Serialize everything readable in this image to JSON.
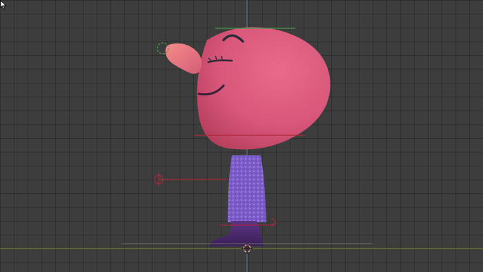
{
  "viewport": {
    "mode": "3d-viewport",
    "view": "side-orthographic",
    "grid": true
  },
  "colors": {
    "background": "#3d3d3d",
    "grid_line": "#2c2c2c",
    "vertical_axis": "#5a7fa0",
    "ground_axis": "#7a8f3a",
    "head": "#d9597a",
    "nose": "#ec7a82",
    "body": "#7b5cc9",
    "boot": "#4b2a6f",
    "rig_red": "#b0283a",
    "rig_green": "#4aa04a",
    "brow": "#2b2b38"
  },
  "scene": {
    "object": "character-rig",
    "parts": [
      "head",
      "nose",
      "body",
      "boot",
      "mouth",
      "eyebrow",
      "eye"
    ],
    "selected": false
  }
}
